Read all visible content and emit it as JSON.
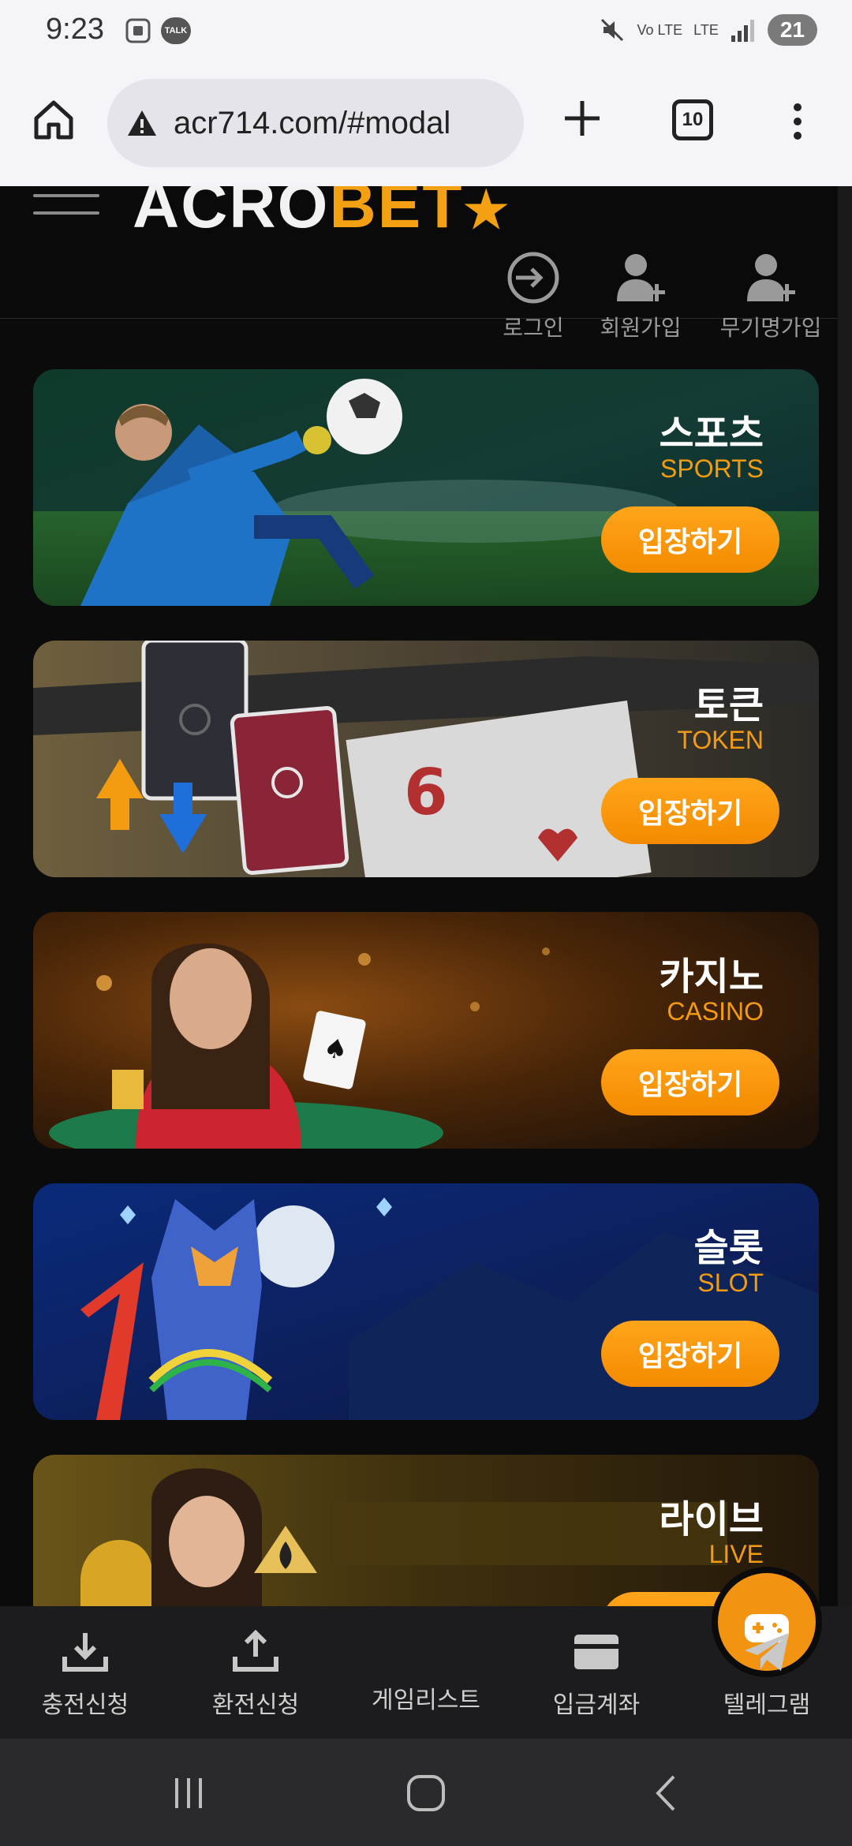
{
  "status": {
    "time": "9:23",
    "notif_talk": "TALK",
    "signal_label_volte": "Vo LTE",
    "signal_label_lte": "LTE",
    "battery": "21"
  },
  "browser": {
    "url": "acr714.com/#modal",
    "tab_count": "10"
  },
  "site": {
    "logo_white": "ACRO",
    "logo_orange": "BET",
    "header_actions": [
      {
        "label": "로그인",
        "icon": "login-icon"
      },
      {
        "label": "회원가입",
        "icon": "add-user-icon"
      },
      {
        "label": "무기명가입",
        "icon": "add-user-icon"
      }
    ],
    "enter_label": "입장하기",
    "banners": [
      {
        "kr": "스포츠",
        "en": "SPORTS"
      },
      {
        "kr": "토큰",
        "en": "TOKEN"
      },
      {
        "kr": "카지노",
        "en": "CASINO"
      },
      {
        "kr": "슬롯",
        "en": "SLOT"
      },
      {
        "kr": "라이브",
        "en": "LIVE"
      }
    ]
  },
  "bottom_nav": [
    {
      "label": "충전신청",
      "icon": "download-icon"
    },
    {
      "label": "환전신청",
      "icon": "upload-icon"
    },
    {
      "label": "게임리스트",
      "icon": "gamepad-icon"
    },
    {
      "label": "입금계좌",
      "icon": "card-icon"
    },
    {
      "label": "텔레그램",
      "icon": "telegram-icon"
    }
  ],
  "colors": {
    "accent": "#f39312",
    "background": "#0b0b0c"
  }
}
